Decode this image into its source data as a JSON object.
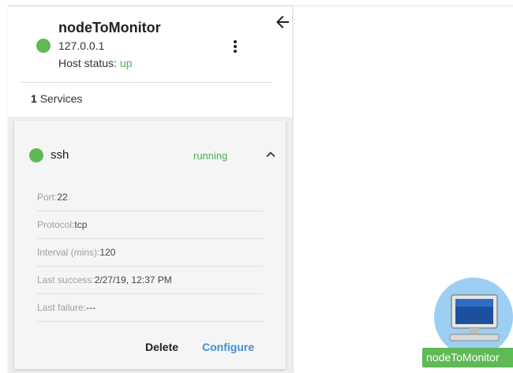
{
  "host": {
    "name": "nodeToMonitor",
    "ip": "127.0.0.1",
    "status_label": "Host status:",
    "status_value": "up",
    "status_color": "#4caf50"
  },
  "services_summary": {
    "count": "1",
    "label": "Services"
  },
  "service": {
    "name": "ssh",
    "status": "running",
    "status_color": "#4caf50",
    "details": [
      {
        "label": "Port:",
        "value": "22"
      },
      {
        "label": "Protocol:",
        "value": "tcp"
      },
      {
        "label": "Interval (mins):",
        "value": "120"
      },
      {
        "label": "Last success:",
        "value": "2/27/19, 12:37 PM"
      },
      {
        "label": "Last failure:",
        "value": "---"
      }
    ],
    "delete_label": "Delete",
    "configure_label": "Configure"
  },
  "canvas_node": {
    "label": "nodeToMonitor",
    "icon": "computer-monitor-icon"
  },
  "icons": {
    "back": "arrow-left-icon",
    "menu": "more-vert-icon",
    "collapse": "chevron-up-icon"
  }
}
